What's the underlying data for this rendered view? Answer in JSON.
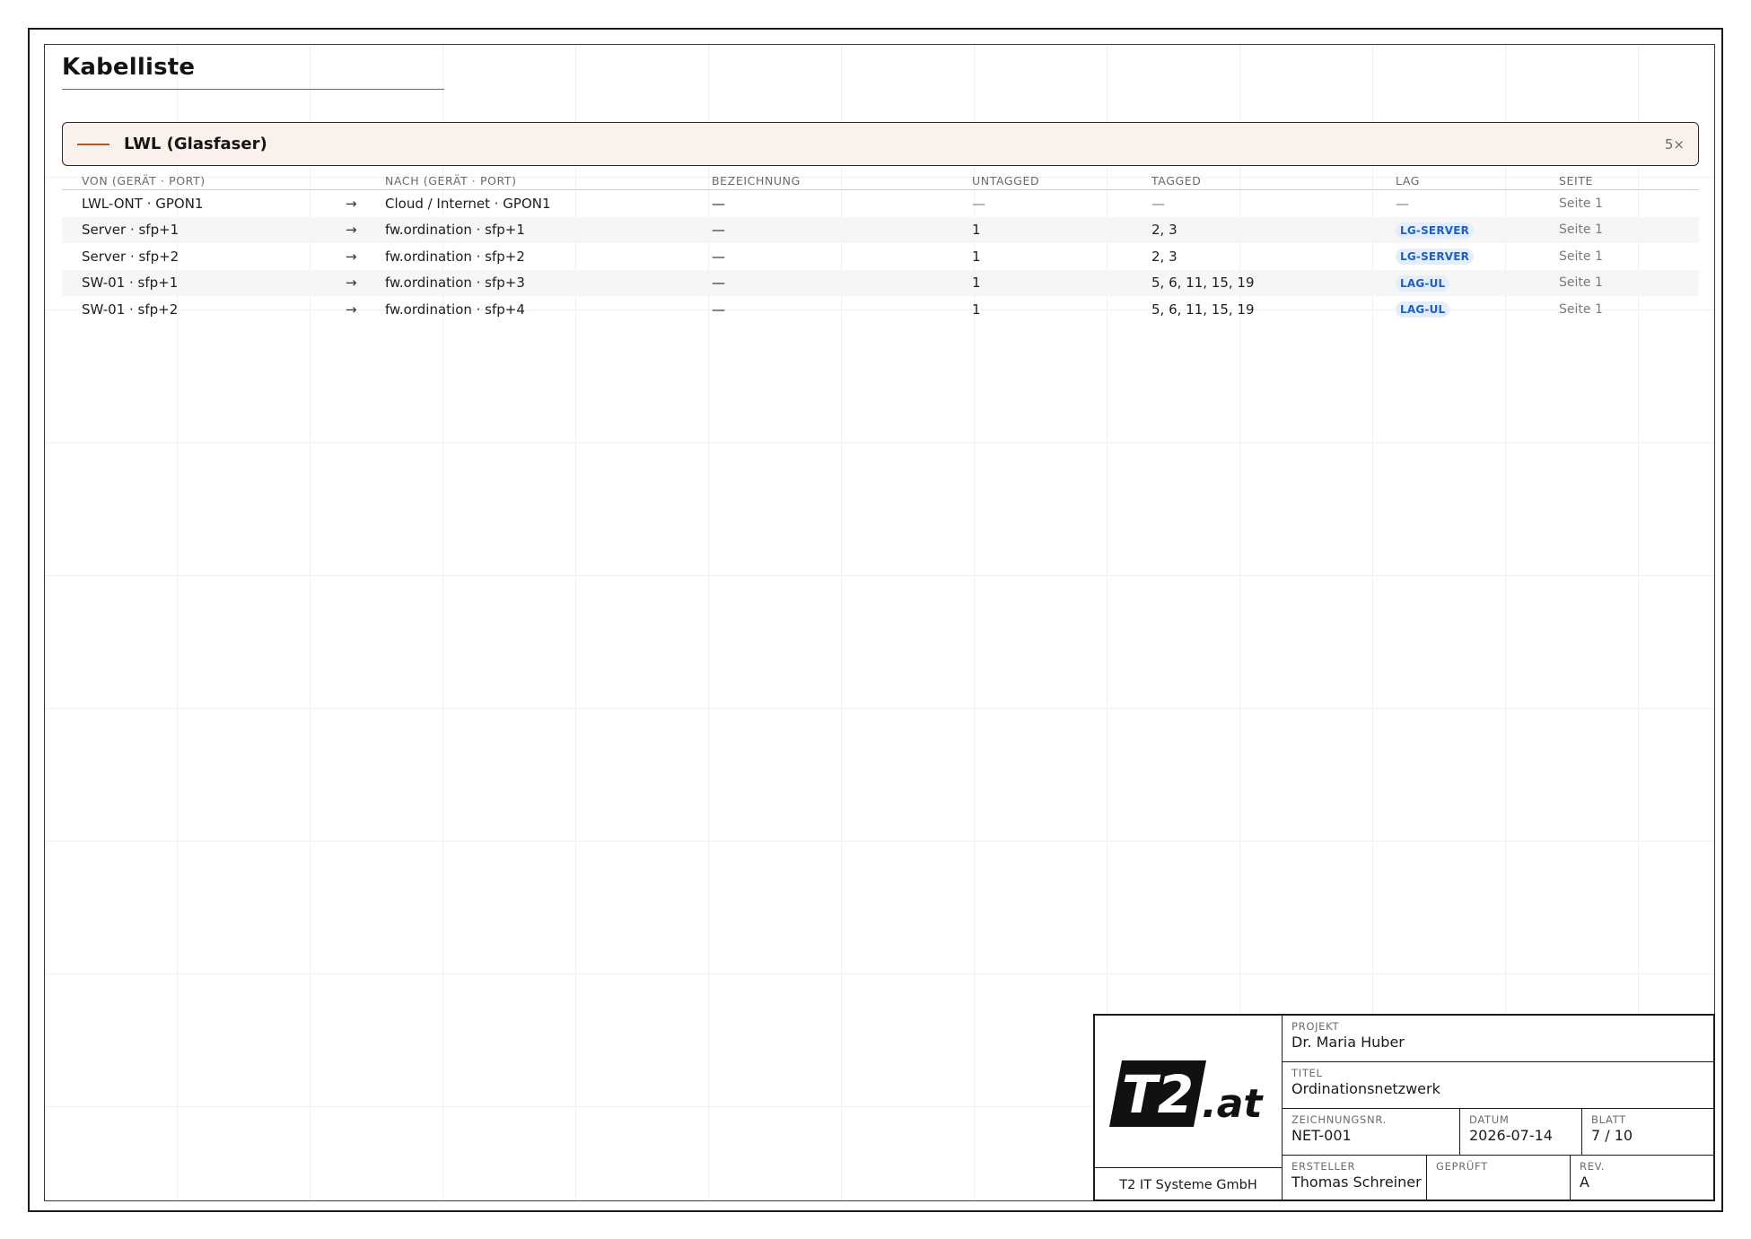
{
  "page": {
    "title": "Kabelliste"
  },
  "group": {
    "name": "LWL (Glasfaser)",
    "count": "5×",
    "color": "#b5532a"
  },
  "table": {
    "headers": [
      "VON (GERÄT · PORT)",
      "NACH (GERÄT · PORT)",
      "BEZEICHNUNG",
      "UNTAGGED",
      "TAGGED",
      "LAG",
      "SEITE"
    ],
    "arrow": "→",
    "rows": [
      {
        "from": "LWL-ONT · GPON1",
        "to": "Cloud / Internet · GPON1",
        "label": "—",
        "untagged": "—",
        "tagged": "—",
        "lag": "—",
        "page": "Seite 1"
      },
      {
        "from": "Server · sfp+1",
        "to": "fw.ordination · sfp+1",
        "label": "—",
        "untagged": "1",
        "tagged": "2, 3",
        "lag": "LG-SERVER",
        "page": "Seite 1"
      },
      {
        "from": "Server · sfp+2",
        "to": "fw.ordination · sfp+2",
        "label": "—",
        "untagged": "1",
        "tagged": "2, 3",
        "lag": "LG-SERVER",
        "page": "Seite 1"
      },
      {
        "from": "SW-01 · sfp+1",
        "to": "fw.ordination · sfp+3",
        "label": "—",
        "untagged": "1",
        "tagged": "5, 6, 11, 15, 19",
        "lag": "LAG-UL",
        "page": "Seite 1"
      },
      {
        "from": "SW-01 · sfp+2",
        "to": "fw.ordination · sfp+4",
        "label": "—",
        "untagged": "1",
        "tagged": "5, 6, 11, 15, 19",
        "lag": "LAG-UL",
        "page": "Seite 1"
      }
    ]
  },
  "title_block": {
    "logo": {
      "mark": "T2",
      "suffix": ".at"
    },
    "company": "T2 IT Systeme GmbH",
    "projekt_label": "PROJEKT",
    "projekt": "Dr. Maria Huber",
    "titel_label": "TITEL",
    "titel": "Ordinationsnetzwerk",
    "zeichnungsnr_label": "ZEICHNUNGSNR.",
    "zeichnungsnr": "NET-001",
    "datum_label": "DATUM",
    "datum": "2026-07-14",
    "blatt_label": "BLATT",
    "blatt": "7 / 10",
    "ersteller_label": "ERSTELLER",
    "ersteller": "Thomas Schreiner",
    "geprueft_label": "GEPRÜFT",
    "geprueft": "",
    "rev_label": "REV.",
    "rev": "A"
  }
}
